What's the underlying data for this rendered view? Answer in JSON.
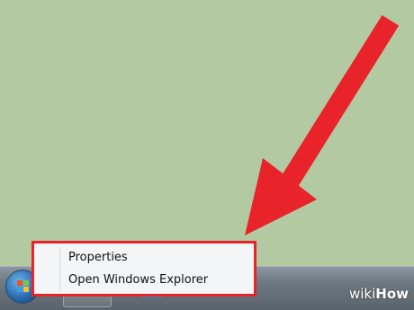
{
  "context_menu": {
    "items": [
      {
        "label": "Properties"
      },
      {
        "label": "Open Windows Explorer"
      }
    ]
  },
  "taskbar": {
    "items": [
      {
        "icon": "start-orb-icon"
      },
      {
        "icon": "chrome-icon"
      },
      {
        "icon": "folder-icon"
      }
    ]
  },
  "annotation": {
    "arrow_color": "#e8242a",
    "highlight_color": "#e8242a"
  },
  "watermark": {
    "part1": "wiki",
    "part2": "How"
  }
}
